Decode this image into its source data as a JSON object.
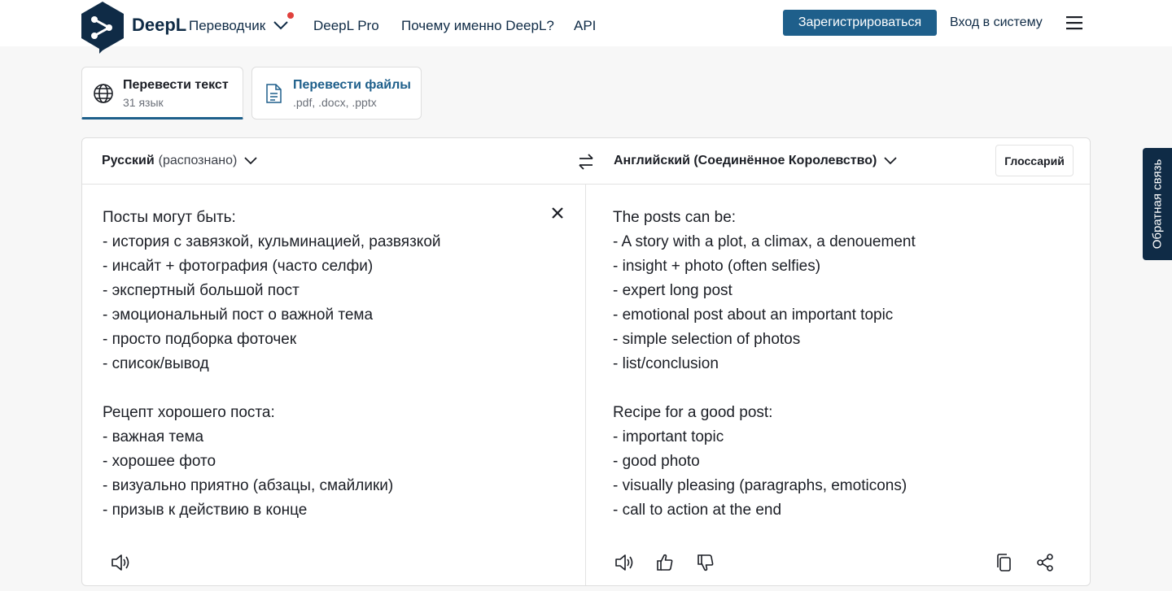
{
  "header": {
    "brand": "DeepL",
    "product": "Переводчик",
    "nav": [
      "DeepL Pro",
      "Почему именно DeepL?",
      "API"
    ],
    "signup_label": "Зарегистрироваться",
    "login_label": "Вход в систему",
    "brand_color": "#0f2b46",
    "accent_color": "#1e5f8b",
    "notification_color": "#e0413d"
  },
  "tabs": [
    {
      "title": "Перевести текст",
      "subtitle": "31 язык",
      "icon": "globe-icon",
      "active": true
    },
    {
      "title": "Перевести файлы",
      "subtitle": ".pdf, .docx, .pptx",
      "icon": "document-icon",
      "active": false
    }
  ],
  "translator": {
    "source_lang": "Русский",
    "source_detected": "(распознано)",
    "target_lang": "Английский (Соединённое Королевство)",
    "glossary_label": "Глоссарий",
    "source_lines": [
      "Посты могут быть:",
      "- история с завязкой, кульминацией, развязкой",
      "- инсайт + фотография (часто селфи)",
      "- экспертный большой пост",
      "- эмоциональный пост о важной тема",
      "- просто подборка фоточек",
      "- список/вывод",
      "",
      "Рецепт хорошего поста:",
      "- важная тема",
      "- хорошее фото",
      "- визуально приятно (абзацы, смайлики)",
      "- призыв к действию в конце"
    ],
    "target_lines": [
      "The posts can be:",
      "- A story with a plot, a climax, a denouement",
      "- insight + photo (often selfies)",
      "- expert long post",
      "- emotional post about an important topic",
      "- simple selection of photos",
      "- list/conclusion",
      "",
      "Recipe for a good post:",
      "- important topic",
      "- good photo",
      "- visually pleasing (paragraphs, emoticons)",
      "- call to action at the end"
    ]
  },
  "feedback_label": "Обратная связь"
}
